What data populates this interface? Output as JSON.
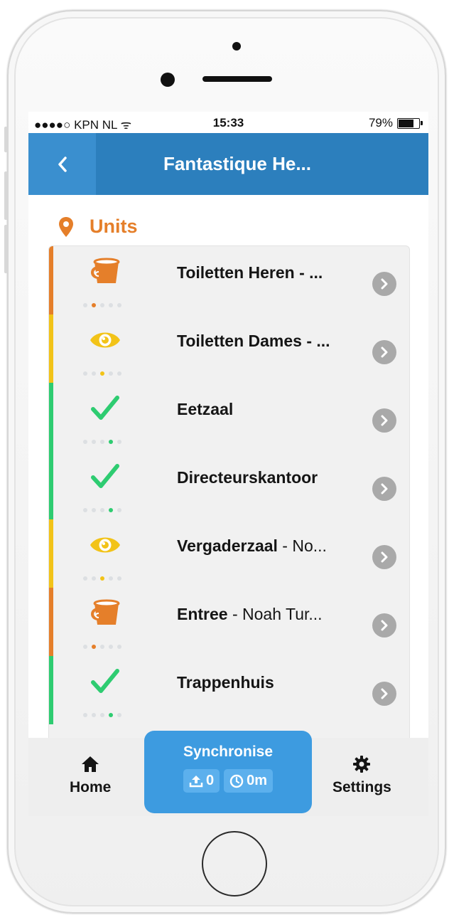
{
  "status_bar": {
    "carrier": "●●●●○ KPN NL",
    "time": "15:33",
    "battery_percent": "79%",
    "battery_level": 0.79
  },
  "navbar": {
    "back_icon": "chevron-left-icon",
    "title": "Fantastique He..."
  },
  "section": {
    "icon": "map-marker-icon",
    "title": "Units"
  },
  "units": [
    {
      "name": "Toiletten Heren - ...",
      "suffix": "",
      "state": "bucket",
      "color": "#e57f2a",
      "active_dot": 1
    },
    {
      "name": "Toiletten Dames - ...",
      "suffix": "",
      "state": "eye",
      "color": "#f2c318",
      "active_dot": 2
    },
    {
      "name": "Eetzaal",
      "suffix": "",
      "state": "check",
      "color": "#2ecc71",
      "active_dot": 3
    },
    {
      "name": "Directeurskantoor",
      "suffix": "",
      "state": "check",
      "color": "#2ecc71",
      "active_dot": 3
    },
    {
      "name": "Vergaderzaal",
      "suffix": " - No...",
      "state": "eye",
      "color": "#f2c318",
      "active_dot": 2
    },
    {
      "name": "Entree",
      "suffix": " - Noah Tur...",
      "state": "bucket",
      "color": "#e57f2a",
      "active_dot": 1
    },
    {
      "name": "Trappenhuis",
      "suffix": "",
      "state": "check",
      "color": "#2ecc71",
      "active_dot": 3
    }
  ],
  "tabbar": {
    "home_label": "Home",
    "settings_label": "Settings",
    "sync_label": "Synchronise",
    "upload_count": "0",
    "time_value": "0m"
  },
  "colors": {
    "navbar": "#2c7fbd",
    "accent_orange": "#e57f2a",
    "warning_yellow": "#f2c318",
    "ok_green": "#2ecc71",
    "sync_blue": "#3d9be0"
  }
}
